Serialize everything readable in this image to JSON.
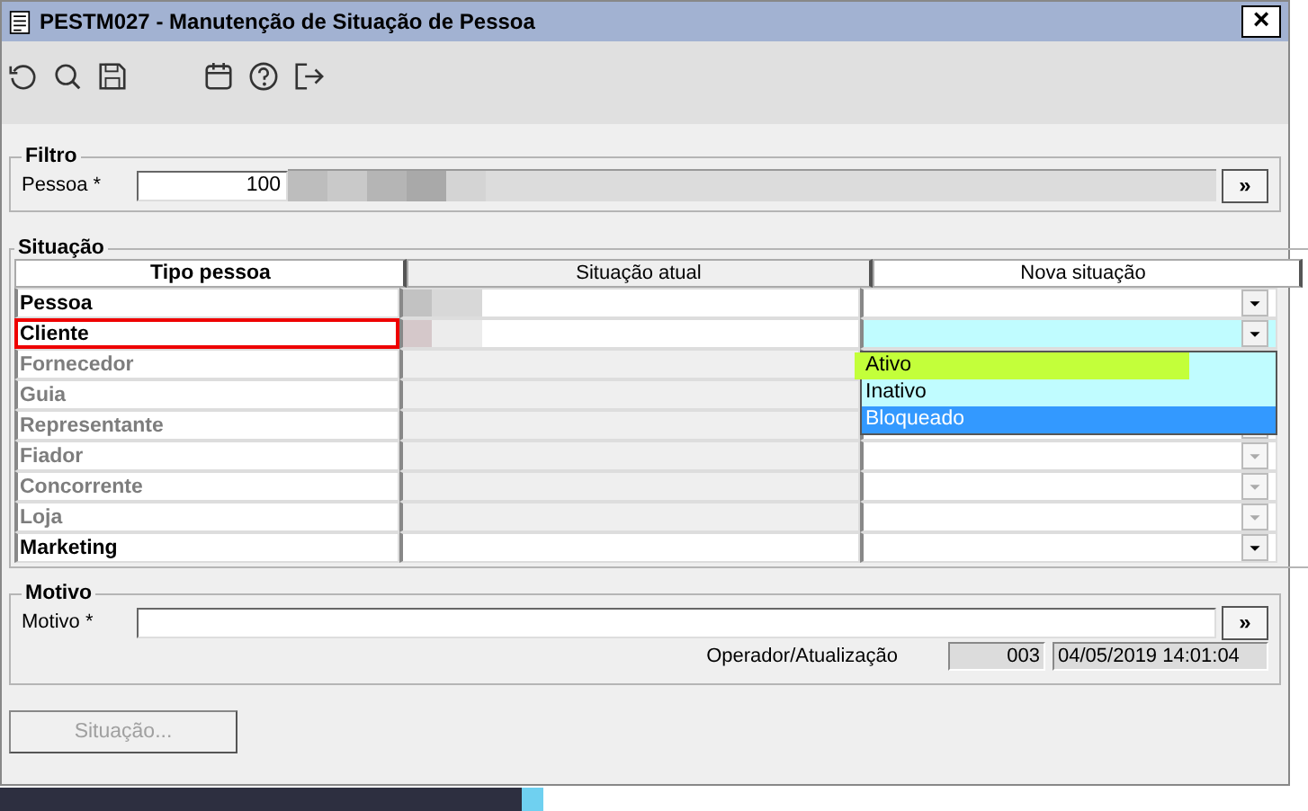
{
  "window": {
    "title": "PESTM027 - Manutenção de Situação de Pessoa",
    "close": "×"
  },
  "filtro": {
    "title": "Filtro",
    "label": "Pessoa *",
    "value": "100",
    "lookup": "»"
  },
  "situacao": {
    "title": "Situação",
    "columns": [
      "Tipo pessoa",
      "Situação atual",
      "Nova situação"
    ],
    "rows": [
      {
        "tipo": "Pessoa",
        "enabled": true,
        "selected": false
      },
      {
        "tipo": "Cliente",
        "enabled": true,
        "selected": true,
        "options": [
          {
            "label": "Ativo",
            "selected": false,
            "highlighted": true
          },
          {
            "label": "Inativo",
            "selected": false,
            "highlighted": false
          },
          {
            "label": "Bloqueado",
            "selected": true,
            "highlighted": false
          }
        ]
      },
      {
        "tipo": "Fornecedor",
        "enabled": false,
        "selected": false
      },
      {
        "tipo": "Guia",
        "enabled": false,
        "selected": false
      },
      {
        "tipo": "Representante",
        "enabled": false,
        "selected": false
      },
      {
        "tipo": "Fiador",
        "enabled": false,
        "selected": false
      },
      {
        "tipo": "Concorrente",
        "enabled": false,
        "selected": false
      },
      {
        "tipo": "Loja",
        "enabled": false,
        "selected": false
      },
      {
        "tipo": "Marketing",
        "enabled": true,
        "selected": false
      }
    ]
  },
  "motivo": {
    "title": "Motivo",
    "label": "Motivo *",
    "lookup": "»",
    "info_label": "Operador/Atualização",
    "operador": "003",
    "data": "04/05/2019 14:01:04"
  },
  "button": {
    "label": "Situação...",
    "disabled": true
  }
}
